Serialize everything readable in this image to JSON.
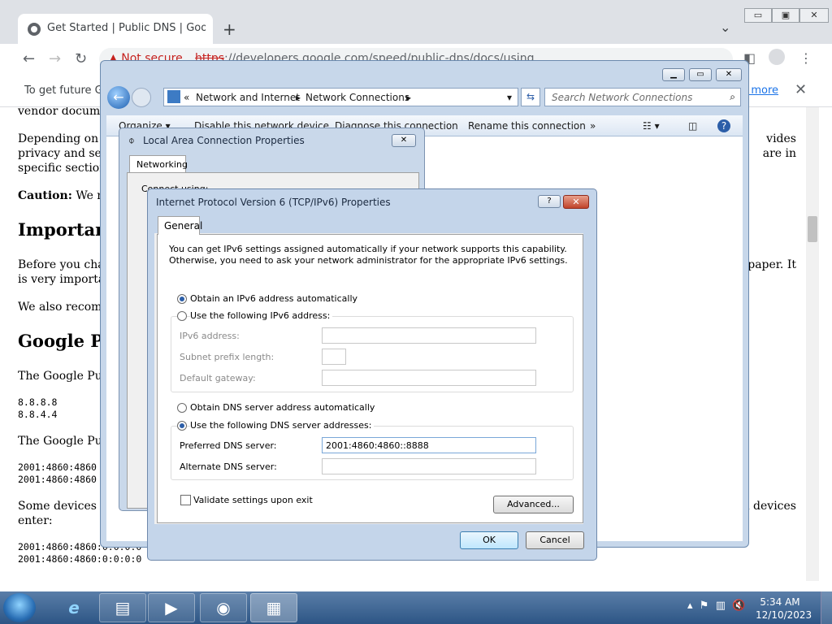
{
  "browser": {
    "tab_title": "Get Started | Public DNS | Goo",
    "new_tab": "+",
    "omnibox_security": "Not secure",
    "url_scheme": "https",
    "url_rest": "://developers.google.com/speed/public-dns/docs/using",
    "infobar_text": "To get future Go",
    "infobar_learn_more": "n more",
    "infobar_close": "✕"
  },
  "page": {
    "line_vendor": "vendor docume",
    "depending_1": "Depending on y",
    "depending_2": "privacy and sec",
    "depending_3": "specific section",
    "right_1": "vides",
    "right_2": "are in",
    "caution_label": "Caution:",
    "caution_text": " We re",
    "heading_important": "Importan",
    "before_1": "Before you char",
    "before_2": "is very importan",
    "right_paper": "f paper. It",
    "also": "We also recomm",
    "heading_google": "Google Pu",
    "google_public": "The Google Pub",
    "ipv4_1": "8.8.8.8",
    "ipv4_2": "8.8.4.4",
    "google_public_2": "The Google Pub",
    "ipv6_1": "2001:4860:4860",
    "ipv6_2": "2001:4860:4860",
    "some_1": "Some devices re",
    "some_2": "enter:",
    "right_devices": "n devices",
    "ipv6_3": "2001:4860:4860:0:0:0:0",
    "ipv6_4": "2001:4860:4860:0:0:0:0"
  },
  "explorer": {
    "crumb_prefix": "«",
    "crumb_1": "Network and Internet",
    "crumb_2": "Network Connections",
    "search_placeholder": "Search Network Connections",
    "cmd_organize": "Organize ▾",
    "cmd_disable": "Disable this network device",
    "cmd_diagnose": "Diagnose this connection",
    "cmd_rename": "Rename this connection",
    "cmd_more": "»"
  },
  "lac": {
    "title": "Local Area Connection Properties",
    "tab": "Networking",
    "connect_using": "Connect using:"
  },
  "ipv6": {
    "title": "Internet Protocol Version 6 (TCP/IPv6) Properties",
    "help": "?",
    "tab": "General",
    "intro_1": "You can get IPv6 settings assigned automatically if your network supports this capability.",
    "intro_2": "Otherwise, you need to ask your network administrator for the appropriate IPv6 settings.",
    "obtain_ip_auto": "Obtain an IPv6 address automatically",
    "use_following_ip": "Use the following IPv6 address:",
    "ipv6_address_label": "IPv6 address:",
    "subnet_label": "Subnet prefix length:",
    "gateway_label": "Default gateway:",
    "obtain_dns_auto": "Obtain DNS server address automatically",
    "use_following_dns": "Use the following DNS server addresses:",
    "preferred_dns_label": "Preferred DNS server:",
    "preferred_dns_value": "2001:4860:4860::8888",
    "alternate_dns_label": "Alternate DNS server:",
    "alternate_dns_value": "",
    "validate_label": "Validate settings upon exit",
    "advanced": "Advanced...",
    "ok": "OK",
    "cancel": "Cancel",
    "ip_mode": "auto",
    "dns_mode": "manual"
  },
  "taskbar": {
    "time": "5:34 AM",
    "date": "12/10/2023"
  },
  "colors": {
    "accent": "#2c5ea8",
    "not_secure": "#c5221f",
    "link": "#1a73e8"
  }
}
